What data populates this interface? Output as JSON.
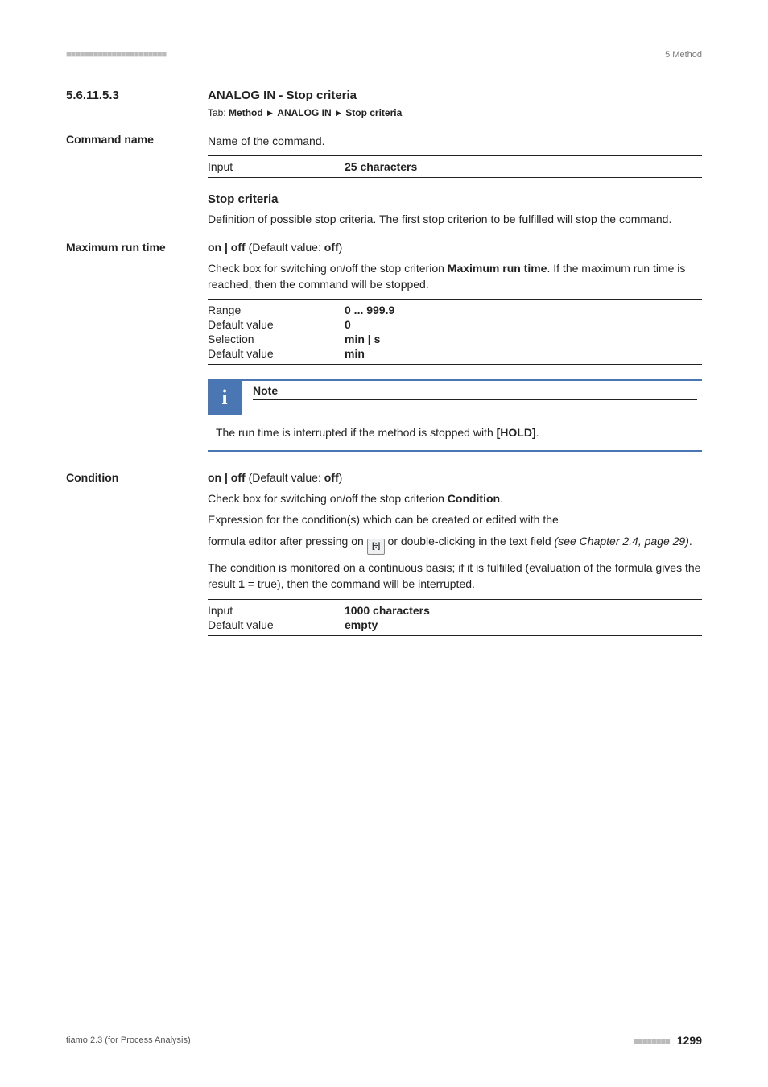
{
  "header": {
    "right": "5 Method"
  },
  "section": {
    "number": "5.6.11.5.3",
    "title": "ANALOG IN - Stop criteria",
    "tab_prefix": "Tab:",
    "tab_parts": [
      "Method",
      "ANALOG IN",
      "Stop criteria"
    ]
  },
  "command_name": {
    "label": "Command name",
    "desc": "Name of the command.",
    "table": [
      {
        "k": "Input",
        "v": "25 characters"
      }
    ]
  },
  "stop_criteria": {
    "heading": "Stop criteria",
    "desc": "Definition of possible stop criteria. The first stop criterion to be fulfilled will stop the command."
  },
  "max_run": {
    "label": "Maximum run time",
    "onoff_pre": "on | off",
    "onoff_mid": " (Default value: ",
    "onoff_val": "off",
    "onoff_post": ")",
    "desc_pre": "Check box for switching on/off the stop criterion ",
    "desc_bold": "Maximum run time",
    "desc_post": ". If the maximum run time is reached, then the command will be stopped.",
    "table": [
      {
        "k": "Range",
        "v": "0 ... 999.9"
      },
      {
        "k": "Default value",
        "v": "0"
      },
      {
        "k": "Selection",
        "v": "min | s"
      },
      {
        "k": "Default value",
        "v": "min"
      }
    ]
  },
  "note": {
    "title": "Note",
    "body_pre": "The run time is interrupted if the method is stopped with ",
    "body_bold": "[HOLD]",
    "body_post": "."
  },
  "condition": {
    "label": "Condition",
    "onoff_pre": "on | off",
    "onoff_mid": " (Default value: ",
    "onoff_val": "off",
    "onoff_post": ")",
    "line1_pre": "Check box for switching on/off the stop criterion ",
    "line1_bold": "Condition",
    "line1_post": ".",
    "line2": "Expression for the condition(s) which can be created or edited with the",
    "line3_pre": "formula editor after pressing on ",
    "line3_post": " or double-clicking in the text field ",
    "line3_ref": "(see Chapter 2.4, page 29)",
    "line3_end": ".",
    "line4_pre": "The condition is monitored on a continuous basis; if it is fulfilled (evaluation of the formula gives the result ",
    "line4_bold": "1",
    "line4_post": " = true), then the command will be interrupted.",
    "table": [
      {
        "k": "Input",
        "v": "1000 characters"
      },
      {
        "k": "Default value",
        "v": "empty"
      }
    ]
  },
  "footer": {
    "left": "tiamo 2.3 (for Process Analysis)",
    "page": "1299"
  },
  "icons": {
    "formula_glyph": "[÷]"
  }
}
